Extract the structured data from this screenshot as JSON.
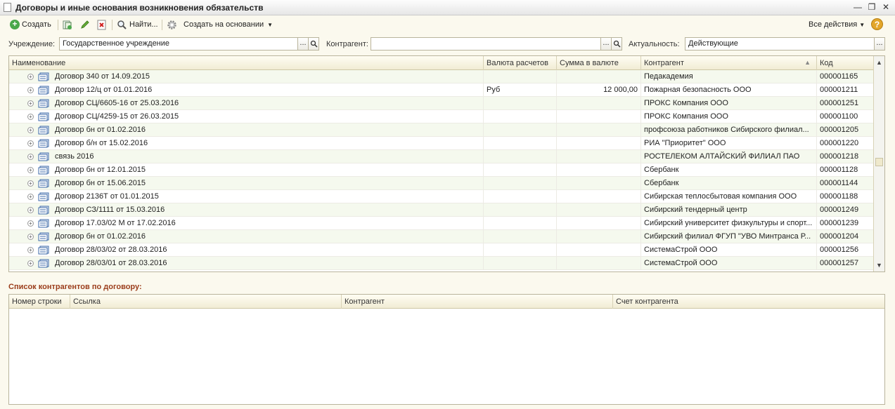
{
  "window": {
    "title": "Договоры и иные основания возникновения обязательств",
    "buttons": {
      "minimize": "—",
      "restore": "❐",
      "close": "✕"
    }
  },
  "toolbar": {
    "create_label": "Создать",
    "find_label": "Найти...",
    "create_based_label": "Создать на основании",
    "all_actions_label": "Все действия",
    "help_label": "?"
  },
  "filters": {
    "institution_label": "Учреждение:",
    "institution_value": "Государственное учреждение",
    "counterparty_label": "Контрагент:",
    "counterparty_value": "",
    "relevance_label": "Актуальность:",
    "relevance_value": "Действующие",
    "select_btn": "...",
    "search_btn": "🔍"
  },
  "table": {
    "columns": [
      "Наименование",
      "Валюта расчетов",
      "Сумма в валюте",
      "Контрагент",
      "Код"
    ],
    "rows": [
      {
        "name": "Договор 340 от 14.09.2015",
        "currency": "",
        "amount": "",
        "counterparty": "Педакадемия",
        "code": "000001165"
      },
      {
        "name": "Договор 12/ц от 01.01.2016",
        "currency": "Руб",
        "amount": "12 000,00",
        "counterparty": "Пожарная безопасность ООО",
        "code": "000001211"
      },
      {
        "name": "Договор СЦ/6605-16 от 25.03.2016",
        "currency": "",
        "amount": "",
        "counterparty": "ПРОКС Компания ООО",
        "code": "000001251"
      },
      {
        "name": "Договор СЦ/4259-15 от 26.03.2015",
        "currency": "",
        "amount": "",
        "counterparty": "ПРОКС Компания ООО",
        "code": "000001100"
      },
      {
        "name": "Договор бн от 01.02.2016",
        "currency": "",
        "amount": "",
        "counterparty": "профсоюза работников Сибирского филиал...",
        "code": "000001205"
      },
      {
        "name": "Договор б/н от 15.02.2016",
        "currency": "",
        "amount": "",
        "counterparty": "РИА \"Приоритет\" ООО",
        "code": "000001220"
      },
      {
        "name": "связь 2016",
        "currency": "",
        "amount": "",
        "counterparty": "РОСТЕЛЕКОМ АЛТАЙСКИЙ ФИЛИАЛ ПАО",
        "code": "000001218"
      },
      {
        "name": "Договор бн от 12.01.2015",
        "currency": "",
        "amount": "",
        "counterparty": "Сбербанк",
        "code": "000001128"
      },
      {
        "name": "Договор бн от 15.06.2015",
        "currency": "",
        "amount": "",
        "counterparty": "Сбербанк",
        "code": "000001144"
      },
      {
        "name": "Договор 2136Т от 01.01.2015",
        "currency": "",
        "amount": "",
        "counterparty": "Сибирская теплосбытовая компания ООО",
        "code": "000001188"
      },
      {
        "name": "Договор СЗ/1111 от 15.03.2016",
        "currency": "",
        "amount": "",
        "counterparty": "Сибирский тендерный центр",
        "code": "000001249"
      },
      {
        "name": "Договор 17.03/02 М от 17.02.2016",
        "currency": "",
        "amount": "",
        "counterparty": "Сибирский университет физкультуры и спорт...",
        "code": "000001239"
      },
      {
        "name": "Договор бн от 01.02.2016",
        "currency": "",
        "amount": "",
        "counterparty": "Сибирский филиал ФГУП \"УВО Минтранса Р...",
        "code": "000001204"
      },
      {
        "name": "Договор 28/03/02 от 28.03.2016",
        "currency": "",
        "amount": "",
        "counterparty": "СистемаСтрой ООО",
        "code": "000001256"
      },
      {
        "name": "Договор 28/03/01 от 28.03.2016",
        "currency": "",
        "amount": "",
        "counterparty": "СистемаСтрой ООО",
        "code": "000001257"
      }
    ]
  },
  "counterparties_section": {
    "title": "Список контрагентов по договору:",
    "columns": [
      "Номер строки",
      "Ссылка",
      "Контрагент",
      "Счет контрагента"
    ]
  },
  "colors": {
    "section_title": "#9b3d1b",
    "background": "#fbf9ee",
    "row_alt": "#f5f9ee"
  }
}
